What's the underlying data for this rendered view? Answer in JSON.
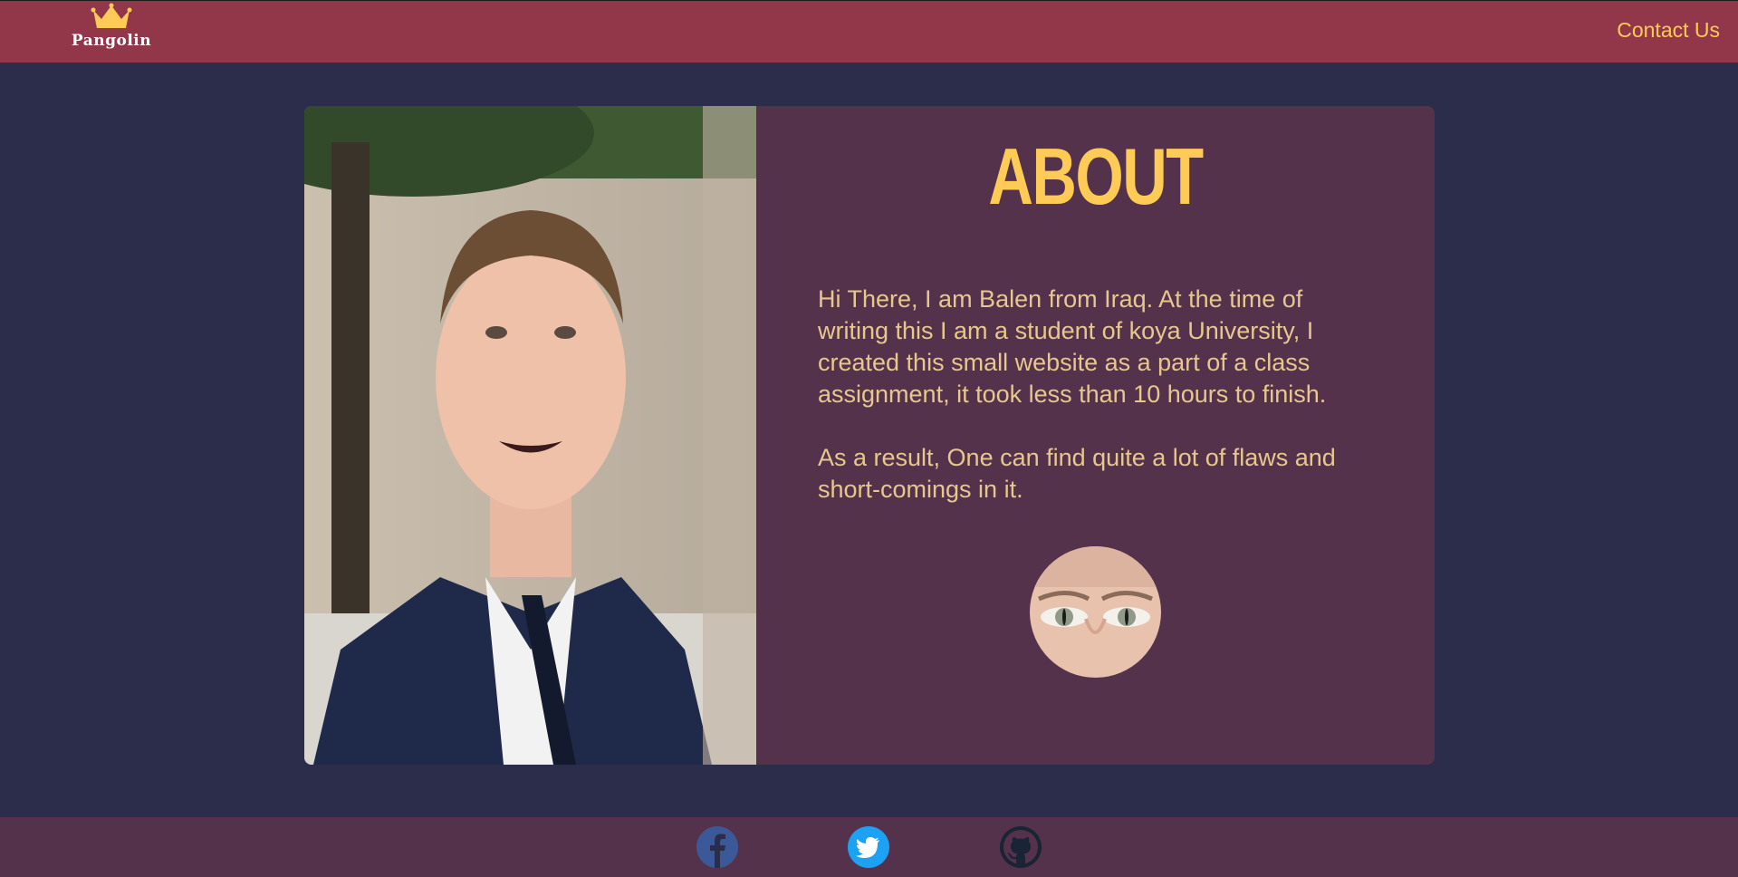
{
  "header": {
    "logo_text": "Pangolin",
    "contact_label": "Contact Us"
  },
  "about": {
    "title": "ABOUT",
    "paragraphs": [
      "Hi There, I am Balen from Iraq. At the time of writing this I am a student of koya University, I created this small website as a part of a class assignment, it took less than 10 hours to finish.",
      "As a result, One can find quite a lot of flaws and short-comings in it."
    ]
  },
  "footer": {
    "social": [
      "facebook-icon",
      "twitter-icon",
      "github-icon"
    ]
  },
  "colors": {
    "header_bg": "#923649",
    "page_bg": "#2b2d4b",
    "card_bg": "#54324b",
    "accent": "#ffcb57",
    "body_text": "#e8c78f",
    "facebook": "#3b5998",
    "twitter": "#1da1f2",
    "github": "#1b2436"
  }
}
